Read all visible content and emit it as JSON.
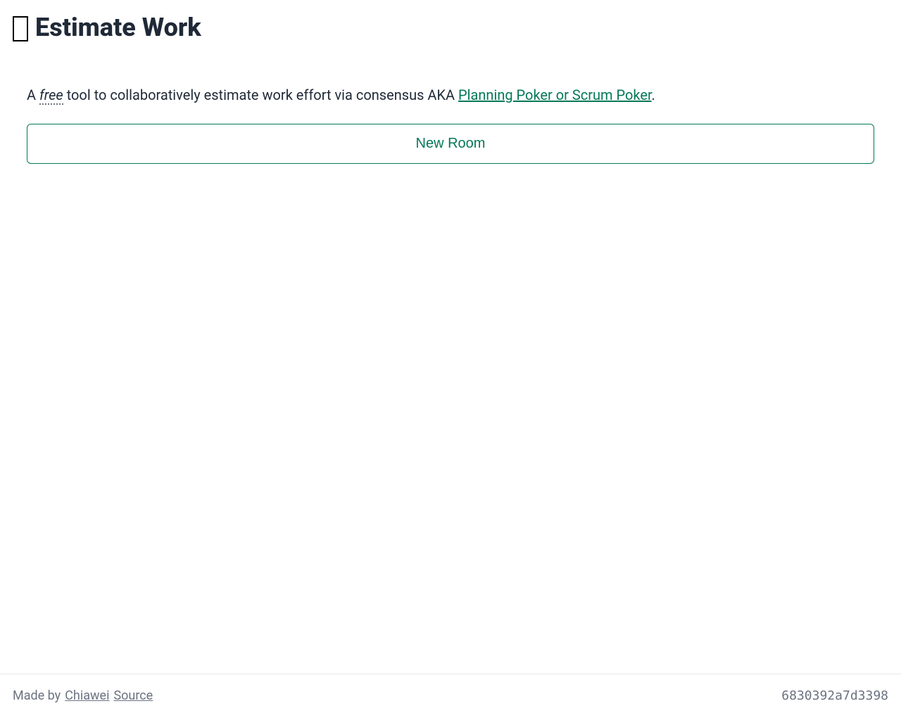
{
  "header": {
    "title": "Estimate Work"
  },
  "main": {
    "desc_prefix": "A ",
    "desc_free": "free",
    "desc_mid": " tool to collaboratively estimate work effort via consensus AKA ",
    "desc_link": "Planning Poker or Scrum Poker",
    "desc_suffix": ".",
    "new_room_button": "New Room"
  },
  "footer": {
    "made_by": "Made by",
    "author": "Chiawei",
    "source": "Source",
    "version": "6830392a7d3398"
  }
}
